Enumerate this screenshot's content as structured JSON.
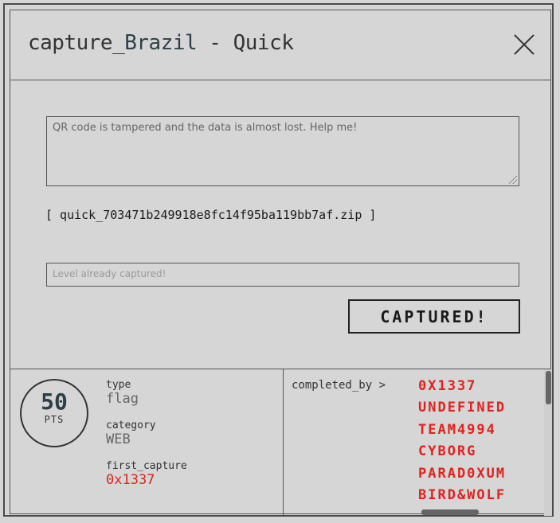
{
  "header": {
    "title_prefix": "capture_",
    "title_highlight": "Brazil",
    "title_suffix": " - Quick"
  },
  "challenge": {
    "description": "QR code is tampered and the data is almost lost. Help me!",
    "file_link": "[ quick_703471b249918e8fc14f95ba119bb7af.zip ]",
    "flag_placeholder": "Level already captured!",
    "submit_label": "CAPTURED!"
  },
  "stats": {
    "points": "50",
    "points_unit": "PTS",
    "type_label": "type",
    "type_value": "flag",
    "category_label": "category",
    "category_value": "WEB",
    "first_capture_label": "first_capture",
    "first_capture_value": "0x1337"
  },
  "completed": {
    "label": "completed_by >",
    "teams": [
      "0X1337",
      "UNDEFINED",
      "TEAM4994",
      "CYBORG",
      "PARAD0XUM",
      "BIRD&WOLF"
    ]
  },
  "colors": {
    "background": "#d6d6d6",
    "accent_red": "#e0221e",
    "title_highlight": "#2e4047"
  }
}
